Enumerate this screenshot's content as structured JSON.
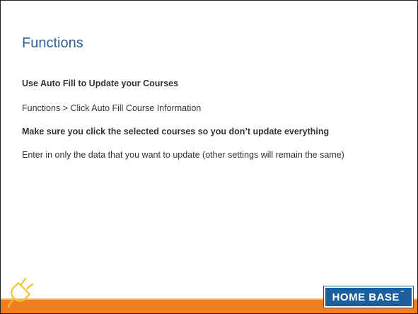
{
  "slide": {
    "title": "Functions",
    "lines": [
      "Use Auto Fill to Update your Courses",
      "Functions > Click Auto Fill Course Information",
      "Make sure you click the selected courses so you don’t update everything",
      "Enter in only the data that you want to update (other settings will remain the same)"
    ]
  },
  "footer": {
    "brand": "HOME BASE",
    "brand_tm": "™",
    "logo_icon": "plug-icon",
    "accent_color": "#f07e22",
    "brand_color": "#1c5d9b"
  }
}
